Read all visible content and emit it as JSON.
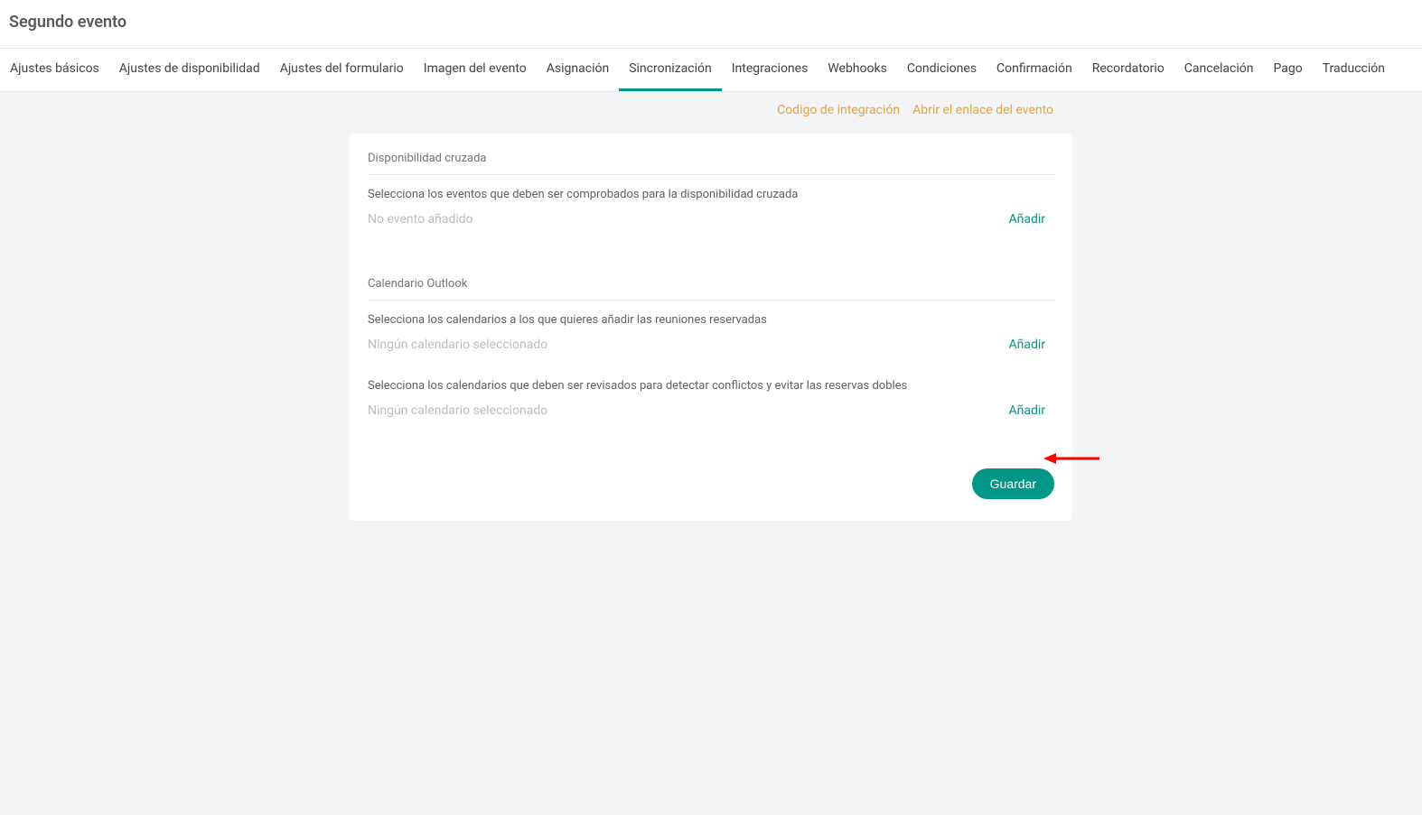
{
  "header": {
    "title": "Segundo evento"
  },
  "tabs": [
    {
      "label": "Ajustes básicos",
      "active": false
    },
    {
      "label": "Ajustes de disponibilidad",
      "active": false
    },
    {
      "label": "Ajustes del formulario",
      "active": false
    },
    {
      "label": "Imagen del evento",
      "active": false
    },
    {
      "label": "Asignación",
      "active": false
    },
    {
      "label": "Sincronización",
      "active": true
    },
    {
      "label": "Integraciones",
      "active": false
    },
    {
      "label": "Webhooks",
      "active": false
    },
    {
      "label": "Condiciones",
      "active": false
    },
    {
      "label": "Confirmación",
      "active": false
    },
    {
      "label": "Recordatorio",
      "active": false
    },
    {
      "label": "Cancelación",
      "active": false
    },
    {
      "label": "Pago",
      "active": false
    },
    {
      "label": "Traducción",
      "active": false
    }
  ],
  "topLinks": {
    "integration": "Codigo de integración",
    "openEvent": "Abrir el enlace del evento"
  },
  "sections": {
    "cross": {
      "title": "Disponibilidad cruzada",
      "desc": "Selecciona los eventos que deben ser comprobados para la disponibilidad cruzada",
      "placeholder": "No evento añadido",
      "add": "Añadir"
    },
    "outlook": {
      "title": "Calendario Outlook",
      "desc1": "Selecciona los calendarios a los que quieres añadir las reuniones reservadas",
      "placeholder1": "Ningún calendario seleccionado",
      "add1": "Añadir",
      "desc2": "Selecciona los calendarios que deben ser revisados para detectar conflictos y evitar las reservas dobles",
      "placeholder2": "Ningún calendario seleccionado",
      "add2": "Añadir"
    }
  },
  "buttons": {
    "save": "Guardar"
  }
}
